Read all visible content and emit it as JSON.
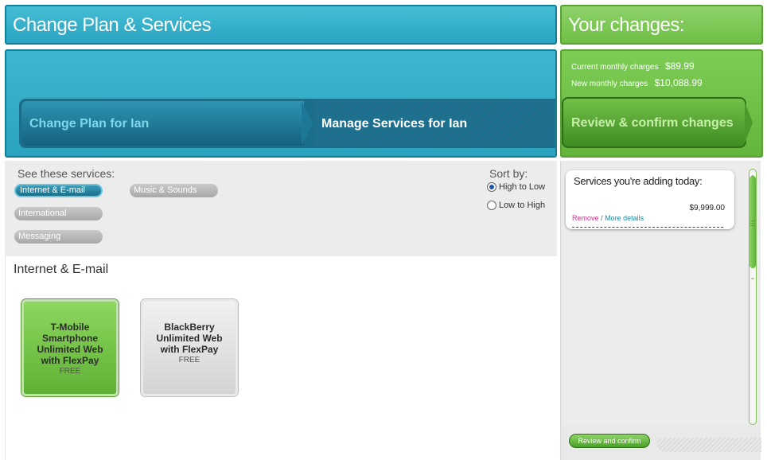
{
  "header": {
    "title": "Change Plan & Services",
    "changes_title": "Your changes:"
  },
  "charges": {
    "current_label": "Current monthly charges",
    "current_value": "$89.99",
    "new_label": "New monthly charges",
    "new_value": "$10,088.99"
  },
  "steps": {
    "step1": "Change Plan for Ian",
    "step2": "Manage Services for Ian",
    "step3": "Review & confirm changes"
  },
  "filters": {
    "see_label": "See these services:",
    "categories": [
      {
        "label": "Internet & E-mail",
        "active": true
      },
      {
        "label": "International",
        "active": false
      },
      {
        "label": "Messaging",
        "active": false
      },
      {
        "label": "Music & Sounds",
        "active": false
      }
    ],
    "sort_label": "Sort by:",
    "sort_options": [
      {
        "label": "High to Low",
        "selected": true
      },
      {
        "label": "Low to High",
        "selected": false
      }
    ]
  },
  "listing": {
    "section_title": "Internet & E-mail",
    "services": [
      {
        "name": "T-Mobile Smartphone Unlimited Web with FlexPay",
        "price": "FREE",
        "selected": true
      },
      {
        "name": "BlackBerry Unlimited Web with FlexPay",
        "price": "FREE",
        "selected": false
      }
    ]
  },
  "sidebar": {
    "adding_title": "Services you're adding today:",
    "adding_price": "$9,999.00",
    "remove_label": "Remove",
    "separator": "/",
    "more_details_label": "More details",
    "review_button": "Review and confirm"
  },
  "colors": {
    "teal": "#2aa5c2",
    "green": "#6fbf46",
    "link_pink": "#d2338f",
    "link_teal": "#1d8fa8"
  }
}
